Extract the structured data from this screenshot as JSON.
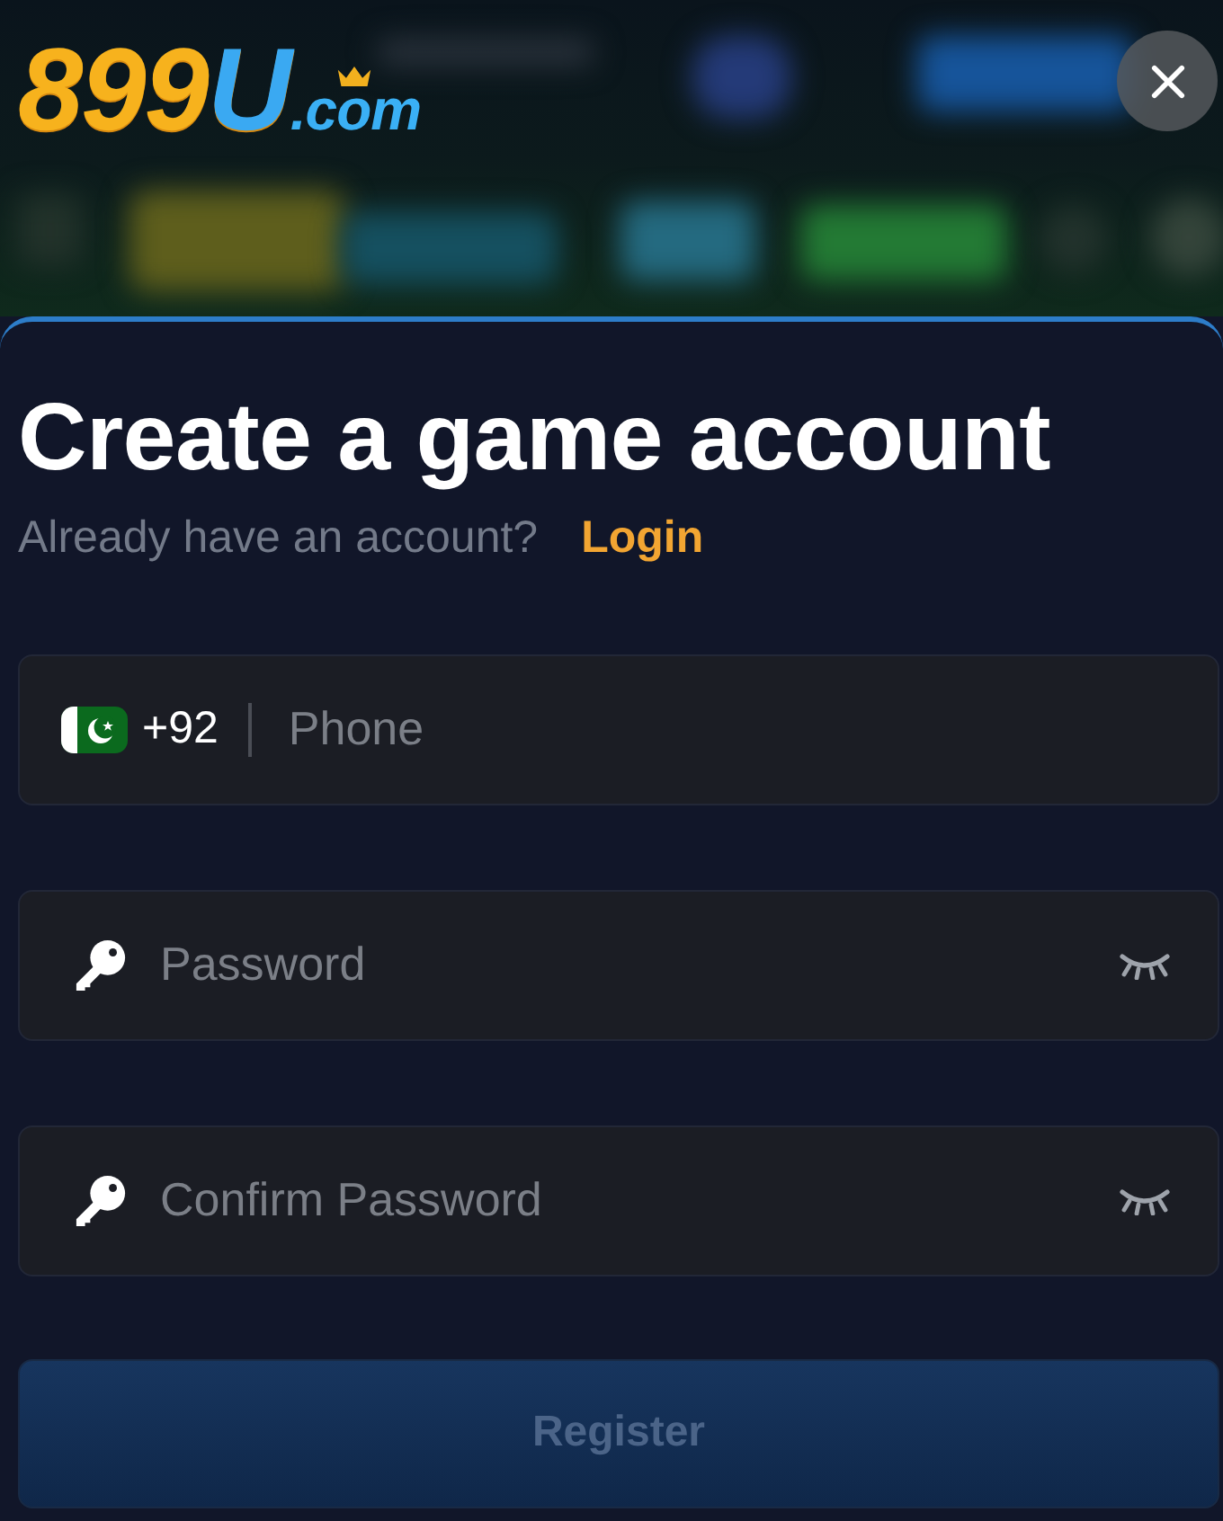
{
  "header": {
    "logo": {
      "main": "899U",
      "suffix": ".com"
    }
  },
  "form": {
    "title": "Create a game account",
    "login_prompt": "Already have an account?",
    "login_link": "Login",
    "fields": [
      {
        "kind": "phone",
        "country_code": "+92",
        "placeholder": "Phone"
      },
      {
        "kind": "password",
        "placeholder": "Password",
        "revealed": false
      },
      {
        "kind": "password",
        "placeholder": "Confirm Password",
        "revealed": false
      }
    ],
    "submit": {
      "label": "Register",
      "disabled": true
    }
  }
}
